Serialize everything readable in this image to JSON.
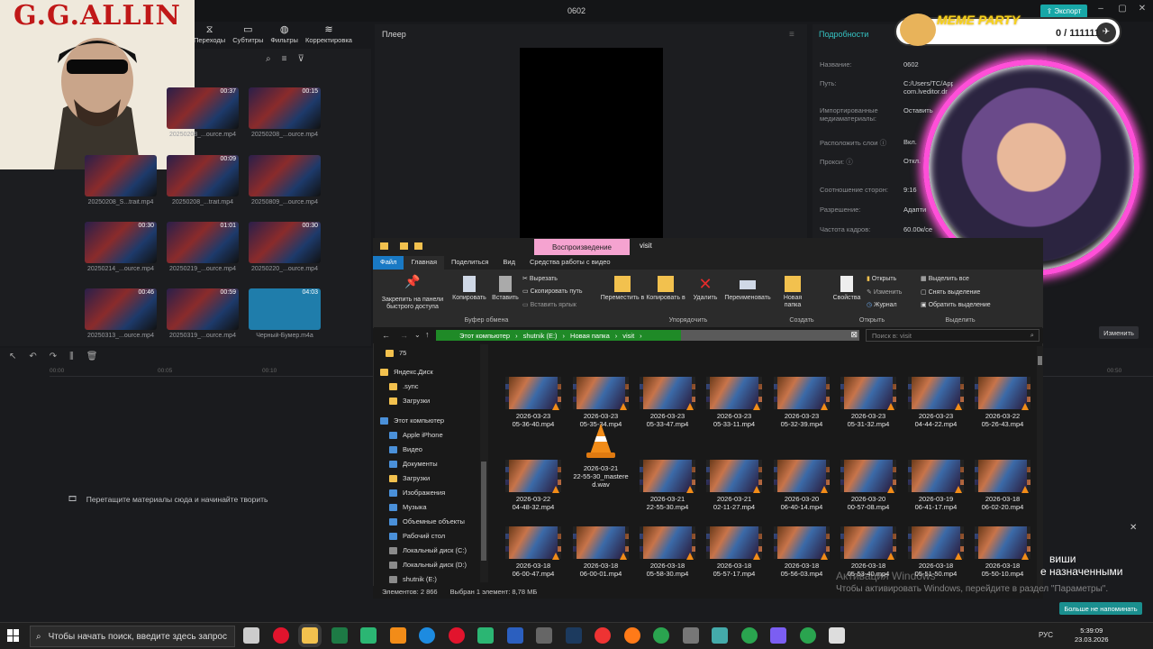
{
  "window": {
    "title": "0602",
    "export_label": "Экспорт"
  },
  "toolbar": [
    {
      "label": "Переходы",
      "icon": "transitions-icon"
    },
    {
      "label": "Субтитры",
      "icon": "subtitles-icon"
    },
    {
      "label": "Фильтры",
      "icon": "filters-icon"
    },
    {
      "label": "Корректировка",
      "icon": "adjustment-icon"
    }
  ],
  "media": {
    "items": [
      {
        "dur": "00:37",
        "name": "20250208_...ource.mp4"
      },
      {
        "dur": "00:15",
        "name": "20250208_...ource.mp4"
      },
      {
        "dur": "",
        "name": "20250208_S...trait.mp4"
      },
      {
        "dur": "00:09",
        "name": "20250208_...trait.mp4"
      },
      {
        "dur": "",
        "name": "20250809_...ource.mp4"
      },
      {
        "dur": "00:30",
        "name": "20250214_...ource.mp4"
      },
      {
        "dur": "01:01",
        "name": "20250219_...ource.mp4"
      },
      {
        "dur": "00:30",
        "name": "20250220_...ource.mp4"
      },
      {
        "dur": "00:46",
        "name": "20250313_...ource.mp4"
      },
      {
        "dur": "00:59",
        "name": "20250319_...ource.mp4"
      },
      {
        "dur": "04:03",
        "name": "Черный-Бумер.m4a"
      }
    ]
  },
  "player": {
    "title": "Плеер"
  },
  "details": {
    "title": "Подробности",
    "rows": [
      {
        "label": "Название:",
        "value": "0602"
      },
      {
        "label": "Путь:",
        "value": "C:/Users/TC/AppD"
      },
      {
        "label": "",
        "value": "com.lveditor.dr"
      },
      {
        "label": "Импортированные",
        "value": "Оставить"
      },
      {
        "label": "медиаматериалы:",
        "value": ""
      },
      {
        "label": "Расположить слои ⓘ",
        "value": "Вкл."
      },
      {
        "label": "Прокси: ⓘ",
        "value": "Откл."
      },
      {
        "label": "Соотношение сторон:",
        "value": "9:16"
      },
      {
        "label": "Разрешение:",
        "value": "Адапти"
      },
      {
        "label": "Частота кадров:",
        "value": "60.00к/се"
      }
    ],
    "modify_label": "Изменить"
  },
  "timeline": {
    "drop_hint": "Перетащите материалы сюда и начинайте творить",
    "ticks": [
      "00:00",
      "00:05",
      "00:10",
      "00:50"
    ]
  },
  "overlay": {
    "logo_text": "G.G.ALLIN",
    "meme_title": "MEME PARTY",
    "meme_count": "0 / 111111"
  },
  "explorer": {
    "context_tab": "Воспроизведение",
    "title": "visit",
    "tabs": [
      "Файл",
      "Главная",
      "Поделиться",
      "Вид",
      "Средства работы с видео"
    ],
    "ribbon": {
      "pin": "Закрепить на панели быстрого доступа",
      "copy": "Копировать",
      "paste": "Вставить",
      "cut": "Вырезать",
      "copy_path": "Скопировать путь",
      "paste_shortcut": "Вставить ярлык",
      "move_to": "Переместить в",
      "copy_to": "Копировать в",
      "delete": "Удалить",
      "rename": "Переименовать",
      "new_folder": "Новая папка",
      "properties": "Свойства",
      "open": "Открыть",
      "edit": "Изменить",
      "history": "Журнал",
      "select_all": "Выделить все",
      "select_none": "Снять выделение",
      "invert_selection": "Обратить выделение",
      "groups": [
        "Буфер обмена",
        "Упорядочить",
        "Создать",
        "Открыть",
        "Выделить"
      ]
    },
    "address": [
      "Этот компьютер",
      "shutnik (E:)",
      "Новая папка",
      "visit"
    ],
    "search_placeholder": "Поиск в: visit",
    "nav": [
      {
        "label": "75",
        "icon": "folder-icon"
      },
      {
        "label": "Яндекс.Диск",
        "icon": "folder-icon"
      },
      {
        "label": ".sync",
        "icon": "folder-icon"
      },
      {
        "label": "Загрузки",
        "icon": "folder-icon"
      },
      {
        "label": "Этот компьютер",
        "icon": "computer-icon"
      },
      {
        "label": "Apple iPhone",
        "icon": "phone-icon"
      },
      {
        "label": "Видео",
        "icon": "video-icon"
      },
      {
        "label": "Документы",
        "icon": "documents-icon"
      },
      {
        "label": "Загрузки",
        "icon": "downloads-icon"
      },
      {
        "label": "Изображения",
        "icon": "images-icon"
      },
      {
        "label": "Музыка",
        "icon": "music-icon"
      },
      {
        "label": "Объемные объекты",
        "icon": "3d-icon"
      },
      {
        "label": "Рабочий стол",
        "icon": "desktop-icon"
      },
      {
        "label": "Локальный диск (C:)",
        "icon": "drive-icon"
      },
      {
        "label": "Локальный диск (D:)",
        "icon": "drive-icon"
      },
      {
        "label": "shutnik (E:)",
        "icon": "drive-icon"
      }
    ],
    "files": [
      [
        "2026-03-23",
        "05-36-40.mp4"
      ],
      [
        "2026-03-23",
        "05-35-34.mp4"
      ],
      [
        "2026-03-23",
        "05-33-47.mp4"
      ],
      [
        "2026-03-23",
        "05-33-11.mp4"
      ],
      [
        "2026-03-23",
        "05-32-39.mp4"
      ],
      [
        "2026-03-23",
        "05-31-32.mp4"
      ],
      [
        "2026-03-23",
        "04-44-22.mp4"
      ],
      [
        "2026-03-22",
        "05-26-43.mp4"
      ],
      [
        "2026-03-22",
        "04-48-32.mp4"
      ],
      [
        "2026-03-21",
        "22-55-30_mastere",
        "d.wav"
      ],
      [
        "2026-03-21",
        "22-55-30.mp4"
      ],
      [
        "2026-03-21",
        "02-11-27.mp4"
      ],
      [
        "2026-03-20",
        "06-40-14.mp4"
      ],
      [
        "2026-03-20",
        "00-57-08.mp4"
      ],
      [
        "2026-03-19",
        "06-41-17.mp4"
      ],
      [
        "2026-03-18",
        "06-02-20.mp4"
      ],
      [
        "2026-03-18",
        "06-00-47.mp4"
      ],
      [
        "2026-03-18",
        "06-00-01.mp4"
      ],
      [
        "2026-03-18",
        "05-58-30.mp4"
      ],
      [
        "2026-03-18",
        "05-57-17.mp4"
      ],
      [
        "2026-03-18",
        "05-56-03.mp4"
      ],
      [
        "2026-03-18",
        "05-53-40.mp4"
      ],
      [
        "2026-03-18",
        "05-51-50.mp4"
      ],
      [
        "2026-03-18",
        "05-50-10.mp4"
      ]
    ],
    "status_count": "Элементов: 2 866",
    "status_selected": "Выбран 1 элемент: 8,78 МБ"
  },
  "notifications": {
    "line1": "виши",
    "line2": "е назначенными",
    "activate1": "Активация Windows",
    "activate2": "Чтобы активировать Windows, перейдите в раздел \"Параметры\".",
    "dont_remind": "Больше не напоминать"
  },
  "taskbar": {
    "search_placeholder": "Чтобы начать поиск, введите здесь запрос",
    "lang": "РУС",
    "time": "5:39:09",
    "date": "23.03.2026"
  },
  "colors": {
    "accent": "#18a7a7",
    "explorer_file_tab": "#1979c4",
    "context_tab": "#f5a3d0",
    "address_bar": "#1f8a27"
  }
}
